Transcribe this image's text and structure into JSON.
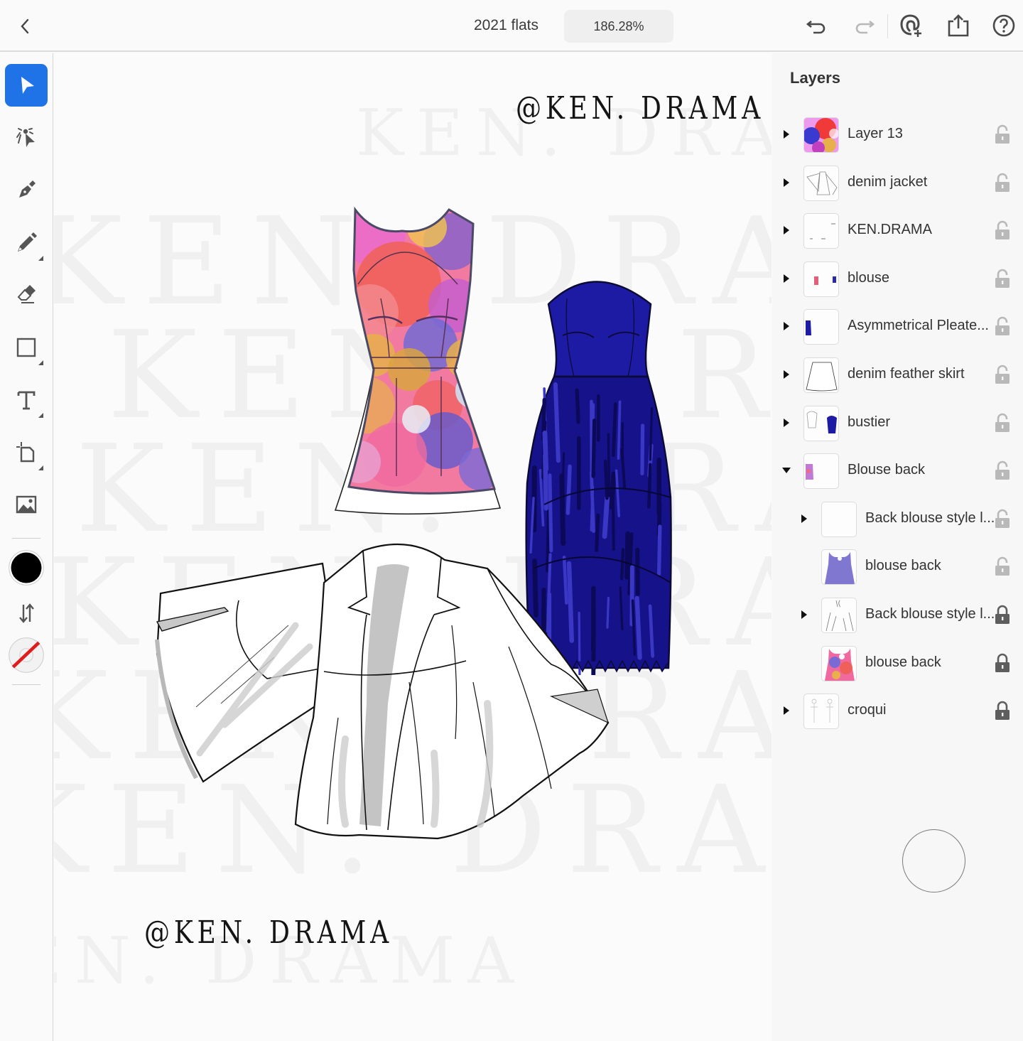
{
  "topbar": {
    "back_icon": "chevron-left-icon",
    "title": "2021 flats",
    "zoom_level": "186.28%",
    "actions": [
      {
        "name": "undo",
        "icon": "undo-icon"
      },
      {
        "name": "redo",
        "icon": "redo-icon",
        "enabled": false
      },
      {
        "name": "invite",
        "icon": "add-user-icon"
      },
      {
        "name": "share",
        "icon": "share-icon"
      },
      {
        "name": "help",
        "icon": "help-icon"
      }
    ]
  },
  "toolbar": {
    "tools": [
      {
        "name": "selection",
        "icon": "arrow-pointer-icon",
        "active": true
      },
      {
        "name": "direct-selection",
        "icon": "direct-select-icon"
      },
      {
        "name": "pen",
        "icon": "pen-nib-icon"
      },
      {
        "name": "pencil",
        "icon": "pencil-icon",
        "has_submenu": true
      },
      {
        "name": "eraser",
        "icon": "eraser-icon"
      },
      {
        "name": "shape",
        "icon": "rectangle-icon",
        "has_submenu": true
      },
      {
        "name": "type",
        "icon": "text-icon",
        "has_submenu": true
      },
      {
        "name": "transform",
        "icon": "crop-icon",
        "has_submenu": true
      },
      {
        "name": "place-image",
        "icon": "image-icon"
      }
    ],
    "fill_color": "#000000",
    "stroke": "none",
    "swap_icon": "swap-arrows-icon"
  },
  "canvas": {
    "watermark_text": "KEN. DRAMA",
    "signature_top": "@KEN. DRAMA",
    "signature_bottom": "@KEN. DRAMA",
    "garments": [
      "printed peplum blouse",
      "blue strapless pleated dress",
      "white bell-sleeve jacket"
    ],
    "colors": {
      "dress_blue": "#1d1aa3",
      "dress_dark": "#0d0b6b",
      "print_pink": "#e86aa8",
      "print_coral": "#f0605a",
      "print_purple": "#7361c9",
      "print_yellow": "#e8b04a",
      "jacket_shade": "#c8c8c8"
    }
  },
  "layers": {
    "title": "Layers",
    "items": [
      {
        "label": "Layer 13",
        "expanded": false,
        "locked": false,
        "indent": 0,
        "thumb": "print"
      },
      {
        "label": "denim jacket",
        "expanded": false,
        "locked": false,
        "indent": 0,
        "thumb": "sketch"
      },
      {
        "label": "KEN.DRAMA",
        "expanded": false,
        "locked": false,
        "indent": 0,
        "thumb": "text"
      },
      {
        "label": "blouse",
        "expanded": false,
        "locked": false,
        "indent": 0,
        "thumb": "blouse"
      },
      {
        "label": "Asymmetrical Pleate...",
        "expanded": false,
        "locked": false,
        "indent": 0,
        "thumb": "blue-skirt"
      },
      {
        "label": "denim feather skirt",
        "expanded": false,
        "locked": false,
        "indent": 0,
        "thumb": "skirt"
      },
      {
        "label": "bustier",
        "expanded": false,
        "locked": false,
        "indent": 0,
        "thumb": "bustier"
      },
      {
        "label": "Blouse back",
        "expanded": true,
        "locked": false,
        "indent": 0,
        "thumb": "blouse-back-small"
      },
      {
        "label": "Back blouse style l...",
        "expanded": false,
        "locked": false,
        "indent": 1,
        "thumb": "empty"
      },
      {
        "label": "blouse back",
        "has_children": false,
        "locked": false,
        "indent": 1,
        "thumb": "purple-top"
      },
      {
        "label": "Back blouse style l...",
        "expanded": false,
        "locked": true,
        "indent": 1,
        "thumb": "sketch-top"
      },
      {
        "label": "blouse back",
        "has_children": false,
        "locked": true,
        "indent": 1,
        "thumb": "print-top"
      },
      {
        "label": "croqui",
        "expanded": false,
        "locked": true,
        "indent": 0,
        "thumb": "croqui"
      }
    ]
  }
}
